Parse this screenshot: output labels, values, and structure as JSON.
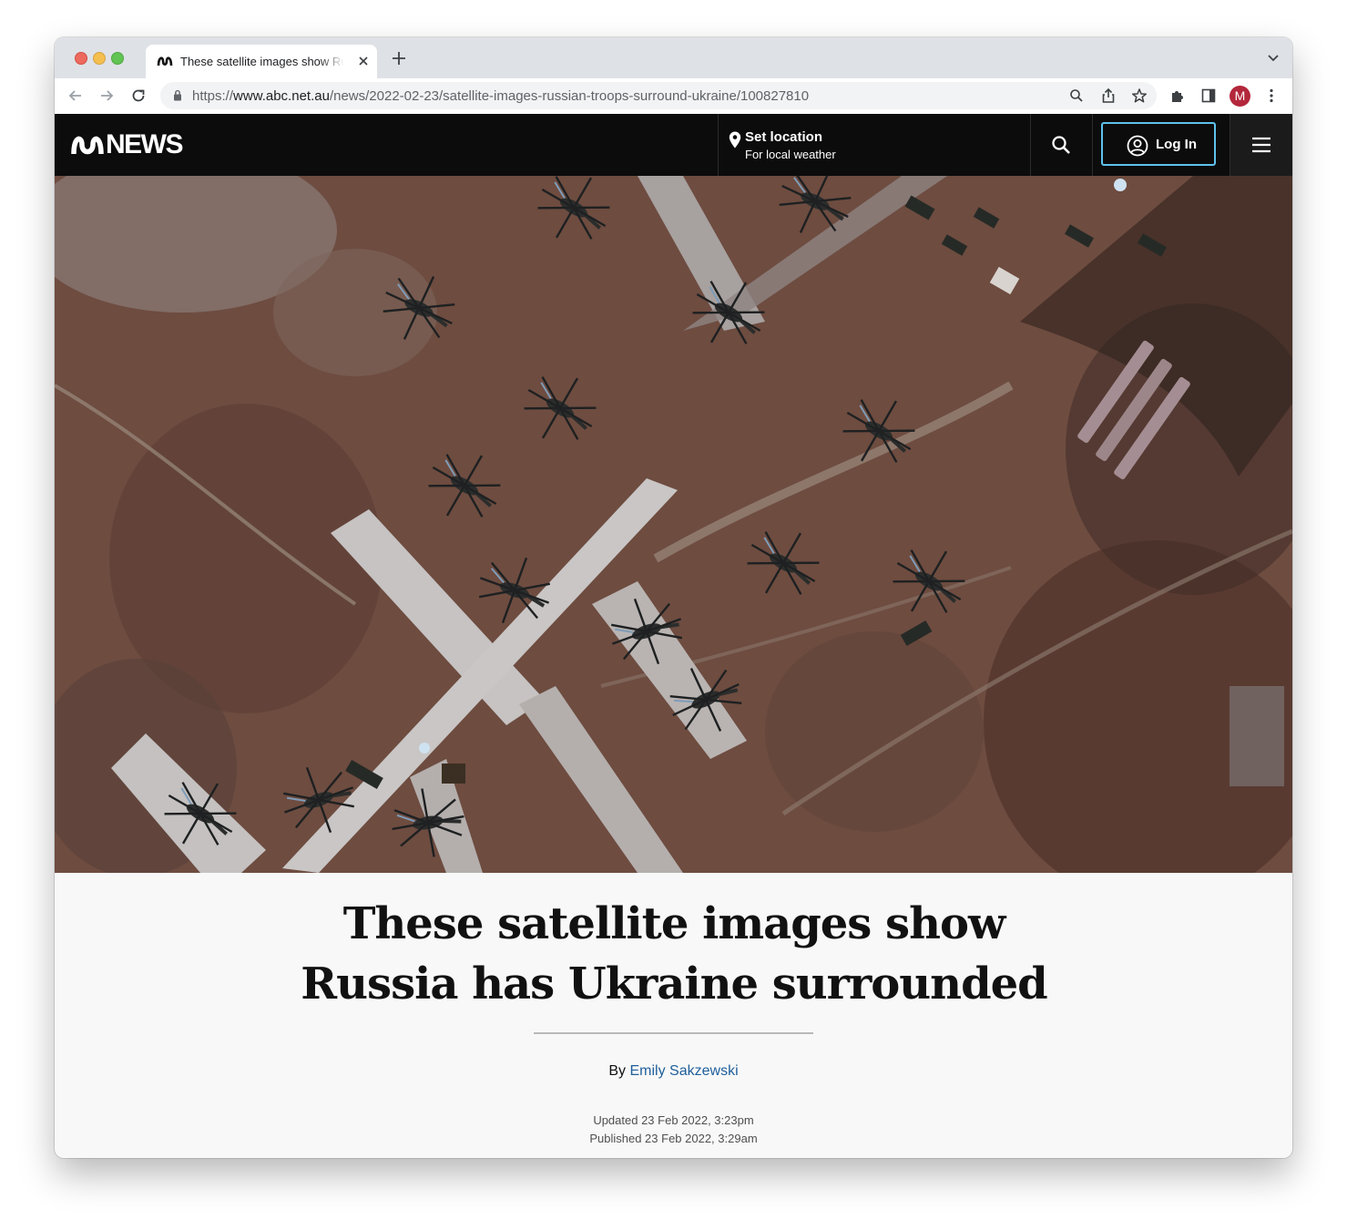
{
  "browser": {
    "tab": {
      "title": "These satellite images show Russia has Ukraine surrounded"
    },
    "url": {
      "scheme": "https://",
      "host": "www.abc.net.au",
      "path": "/news/2022-02-23/satellite-images-russian-troops-surround-ukraine/100827810"
    },
    "profile_initial": "M"
  },
  "site": {
    "logo_text": "NEWS",
    "location": {
      "title": "Set location",
      "subtitle": "For local weather"
    },
    "login_label": "Log In"
  },
  "article": {
    "headline_line1": "These satellite images show",
    "headline_line2": "Russia has Ukraine surrounded",
    "byline_prefix": "By",
    "author": "Emily Sakzewski",
    "updated": "Updated 23 Feb 2022, 3:23pm",
    "published": "Published 23 Feb 2022, 3:29am"
  },
  "colors": {
    "header_bg": "#0c0c0c",
    "login_border": "#5fc2ec",
    "author_link": "#20609c",
    "profile_bg": "#b3273b"
  },
  "icons": [
    "abc-logo-icon",
    "close-icon",
    "plus-icon",
    "chevron-down-icon",
    "back-arrow-icon",
    "forward-arrow-icon",
    "reload-icon",
    "lock-icon",
    "zoom-icon",
    "share-icon",
    "star-icon",
    "extensions-icon",
    "sidepanel-icon",
    "kebab-menu-icon",
    "location-pin-icon",
    "search-icon",
    "user-circle-icon",
    "hamburger-icon"
  ]
}
